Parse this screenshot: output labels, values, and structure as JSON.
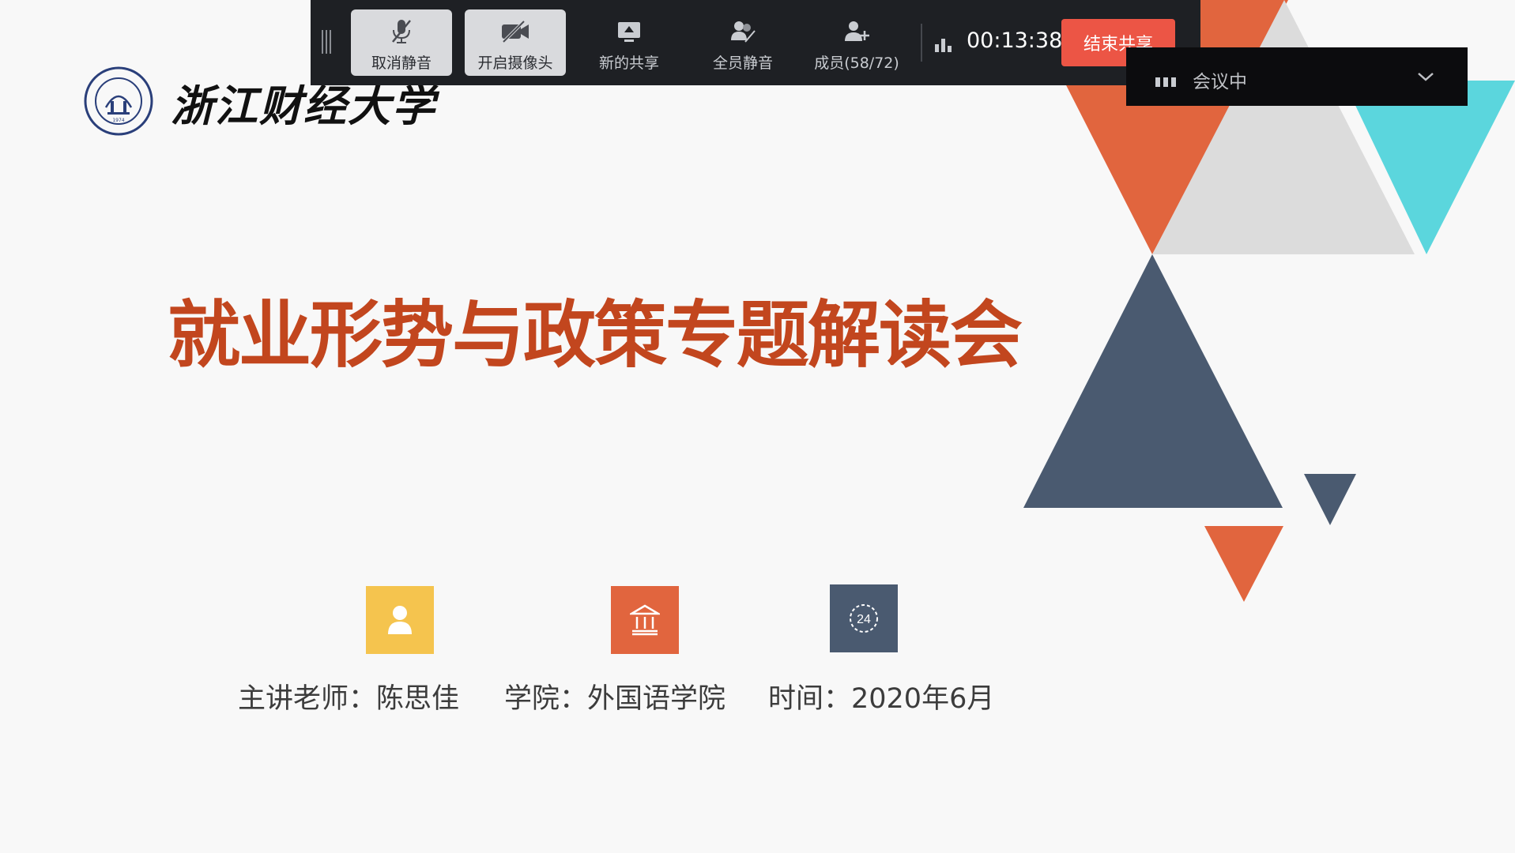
{
  "colors": {
    "orange": "#e1653e",
    "light_gray": "#dcdcdc",
    "cyan": "#5bd6dd",
    "slate": "#4a5a70",
    "yellow": "#f5c44e",
    "title_red": "#c2461e",
    "end_button": "#ec5545"
  },
  "toolbar": {
    "buttons": [
      {
        "label": "取消静音",
        "icon": "microphone-muted-icon"
      },
      {
        "label": "开启摄像头",
        "icon": "camera-off-icon"
      },
      {
        "label": "新的共享",
        "icon": "screen-share-icon"
      },
      {
        "label": "全员静音",
        "icon": "mute-all-icon"
      },
      {
        "label": "成员(58/72)",
        "icon": "add-member-icon"
      }
    ],
    "timer": "00:13:38",
    "end_share_label": "结束共享"
  },
  "meeting_status": {
    "label": "会议中"
  },
  "logo": {
    "name": "浙江财经大学"
  },
  "slide": {
    "title": "就业形势与政策专题解读会",
    "items": [
      {
        "icon": "person-icon",
        "text": "主讲老师：陈思佳"
      },
      {
        "icon": "institution-icon",
        "text": "学院：外国语学院"
      },
      {
        "icon": "clock-24-icon",
        "text": "时间：2020年6月"
      }
    ]
  }
}
